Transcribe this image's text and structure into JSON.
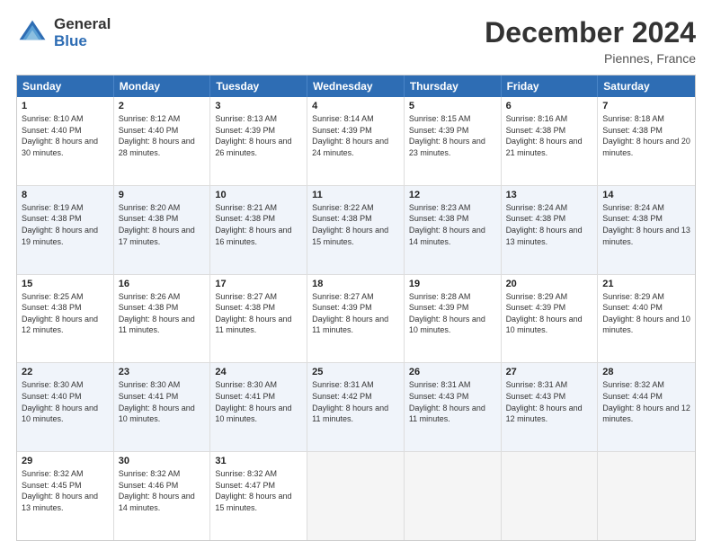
{
  "logo": {
    "general": "General",
    "blue": "Blue"
  },
  "header": {
    "month": "December 2024",
    "location": "Piennes, France"
  },
  "days": [
    "Sunday",
    "Monday",
    "Tuesday",
    "Wednesday",
    "Thursday",
    "Friday",
    "Saturday"
  ],
  "weeks": [
    [
      {
        "day": "1",
        "sunrise": "8:10 AM",
        "sunset": "4:40 PM",
        "daylight": "8 hours and 30 minutes."
      },
      {
        "day": "2",
        "sunrise": "8:12 AM",
        "sunset": "4:40 PM",
        "daylight": "8 hours and 28 minutes."
      },
      {
        "day": "3",
        "sunrise": "8:13 AM",
        "sunset": "4:39 PM",
        "daylight": "8 hours and 26 minutes."
      },
      {
        "day": "4",
        "sunrise": "8:14 AM",
        "sunset": "4:39 PM",
        "daylight": "8 hours and 24 minutes."
      },
      {
        "day": "5",
        "sunrise": "8:15 AM",
        "sunset": "4:39 PM",
        "daylight": "8 hours and 23 minutes."
      },
      {
        "day": "6",
        "sunrise": "8:16 AM",
        "sunset": "4:38 PM",
        "daylight": "8 hours and 21 minutes."
      },
      {
        "day": "7",
        "sunrise": "8:18 AM",
        "sunset": "4:38 PM",
        "daylight": "8 hours and 20 minutes."
      }
    ],
    [
      {
        "day": "8",
        "sunrise": "8:19 AM",
        "sunset": "4:38 PM",
        "daylight": "8 hours and 19 minutes."
      },
      {
        "day": "9",
        "sunrise": "8:20 AM",
        "sunset": "4:38 PM",
        "daylight": "8 hours and 17 minutes."
      },
      {
        "day": "10",
        "sunrise": "8:21 AM",
        "sunset": "4:38 PM",
        "daylight": "8 hours and 16 minutes."
      },
      {
        "day": "11",
        "sunrise": "8:22 AM",
        "sunset": "4:38 PM",
        "daylight": "8 hours and 15 minutes."
      },
      {
        "day": "12",
        "sunrise": "8:23 AM",
        "sunset": "4:38 PM",
        "daylight": "8 hours and 14 minutes."
      },
      {
        "day": "13",
        "sunrise": "8:24 AM",
        "sunset": "4:38 PM",
        "daylight": "8 hours and 13 minutes."
      },
      {
        "day": "14",
        "sunrise": "8:24 AM",
        "sunset": "4:38 PM",
        "daylight": "8 hours and 13 minutes."
      }
    ],
    [
      {
        "day": "15",
        "sunrise": "8:25 AM",
        "sunset": "4:38 PM",
        "daylight": "8 hours and 12 minutes."
      },
      {
        "day": "16",
        "sunrise": "8:26 AM",
        "sunset": "4:38 PM",
        "daylight": "8 hours and 11 minutes."
      },
      {
        "day": "17",
        "sunrise": "8:27 AM",
        "sunset": "4:38 PM",
        "daylight": "8 hours and 11 minutes."
      },
      {
        "day": "18",
        "sunrise": "8:27 AM",
        "sunset": "4:39 PM",
        "daylight": "8 hours and 11 minutes."
      },
      {
        "day": "19",
        "sunrise": "8:28 AM",
        "sunset": "4:39 PM",
        "daylight": "8 hours and 10 minutes."
      },
      {
        "day": "20",
        "sunrise": "8:29 AM",
        "sunset": "4:39 PM",
        "daylight": "8 hours and 10 minutes."
      },
      {
        "day": "21",
        "sunrise": "8:29 AM",
        "sunset": "4:40 PM",
        "daylight": "8 hours and 10 minutes."
      }
    ],
    [
      {
        "day": "22",
        "sunrise": "8:30 AM",
        "sunset": "4:40 PM",
        "daylight": "8 hours and 10 minutes."
      },
      {
        "day": "23",
        "sunrise": "8:30 AM",
        "sunset": "4:41 PM",
        "daylight": "8 hours and 10 minutes."
      },
      {
        "day": "24",
        "sunrise": "8:30 AM",
        "sunset": "4:41 PM",
        "daylight": "8 hours and 10 minutes."
      },
      {
        "day": "25",
        "sunrise": "8:31 AM",
        "sunset": "4:42 PM",
        "daylight": "8 hours and 11 minutes."
      },
      {
        "day": "26",
        "sunrise": "8:31 AM",
        "sunset": "4:43 PM",
        "daylight": "8 hours and 11 minutes."
      },
      {
        "day": "27",
        "sunrise": "8:31 AM",
        "sunset": "4:43 PM",
        "daylight": "8 hours and 12 minutes."
      },
      {
        "day": "28",
        "sunrise": "8:32 AM",
        "sunset": "4:44 PM",
        "daylight": "8 hours and 12 minutes."
      }
    ],
    [
      {
        "day": "29",
        "sunrise": "8:32 AM",
        "sunset": "4:45 PM",
        "daylight": "8 hours and 13 minutes."
      },
      {
        "day": "30",
        "sunrise": "8:32 AM",
        "sunset": "4:46 PM",
        "daylight": "8 hours and 14 minutes."
      },
      {
        "day": "31",
        "sunrise": "8:32 AM",
        "sunset": "4:47 PM",
        "daylight": "8 hours and 15 minutes."
      },
      null,
      null,
      null,
      null
    ]
  ]
}
